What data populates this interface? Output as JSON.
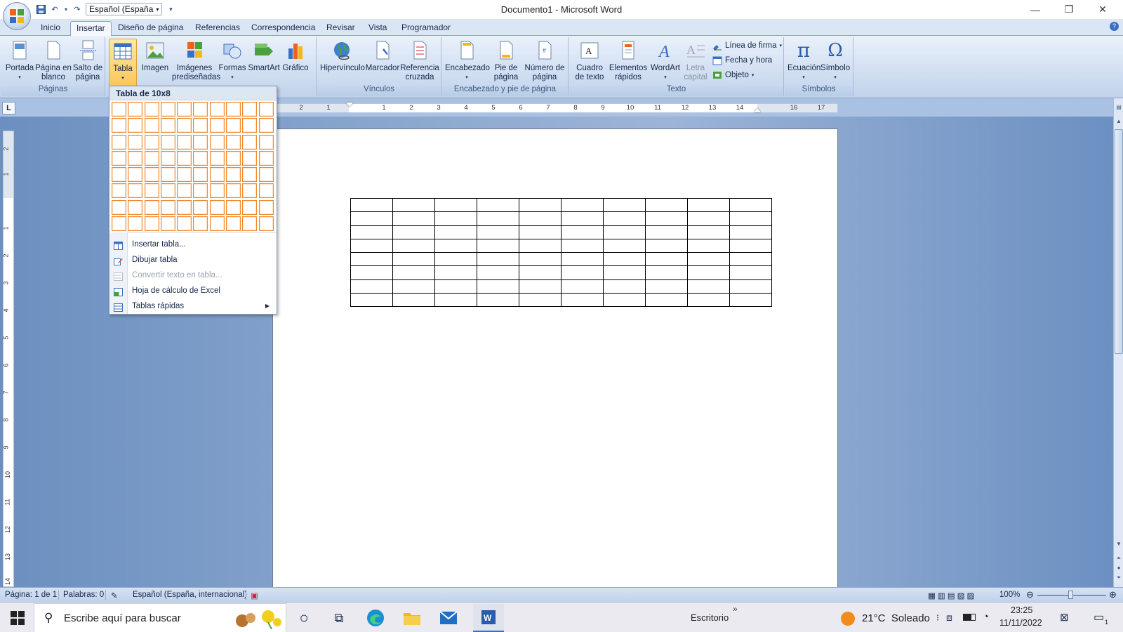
{
  "window": {
    "title": "Documento1 - Microsoft Word",
    "language_box": "Español (España",
    "minimize": "—",
    "restore": "❐",
    "close": "✕"
  },
  "tabs": [
    "Inicio",
    "Insertar",
    "Diseño de página",
    "Referencias",
    "Correspondencia",
    "Revisar",
    "Vista",
    "Programador"
  ],
  "ribbon": {
    "groups": {
      "paginas": "Páginas",
      "vinculos": "Vínculos",
      "encabezado": "Encabezado y pie de página",
      "texto": "Texto",
      "simbolos": "Símbolos"
    },
    "buttons": {
      "portada": "Portada",
      "pagina_en_blanco_1": "Página en",
      "pagina_en_blanco_2": "blanco",
      "salto_1": "Salto de",
      "salto_2": "página",
      "tabla": "Tabla",
      "imagen": "Imagen",
      "imagenes_1": "Imágenes",
      "imagenes_2": "prediseñadas",
      "formas": "Formas",
      "smartart": "SmartArt",
      "grafico": "Gráfico",
      "hipervinculo": "Hipervínculo",
      "marcador": "Marcador",
      "referencia_1": "Referencia",
      "referencia_2": "cruzada",
      "encabezado": "Encabezado",
      "pie_1": "Pie de",
      "pie_2": "página",
      "numero_1": "Número de",
      "numero_2": "página",
      "cuadro_1": "Cuadro",
      "cuadro_2": "de texto",
      "elementos_1": "Elementos",
      "elementos_2": "rápidos",
      "wordart": "WordArt",
      "letra_1": "Letra",
      "letra_2": "capital",
      "linea_firma": "Línea de firma",
      "fecha_hora": "Fecha y hora",
      "objeto": "Objeto",
      "ecuacion": "Ecuación",
      "simbolo": "Símbolo"
    }
  },
  "table_menu": {
    "title": "Tabla de 10x8",
    "grid_cols": 10,
    "grid_rows": 8,
    "items": [
      {
        "label": "Insertar tabla...",
        "enabled": true
      },
      {
        "label": "Dibujar tabla",
        "enabled": true
      },
      {
        "label": "Convertir texto en tabla...",
        "enabled": false
      },
      {
        "label": "Hoja de cálculo de Excel",
        "enabled": true
      },
      {
        "label": "Tablas rápidas",
        "enabled": true
      }
    ]
  },
  "ruler": {
    "h_numbers": [
      "2",
      "1",
      "1",
      "2",
      "3",
      "4",
      "5",
      "6",
      "7",
      "8",
      "9",
      "10",
      "11",
      "12",
      "13",
      "14",
      "16",
      "17"
    ],
    "v_numbers": [
      "2",
      "1",
      "1",
      "2",
      "3",
      "4",
      "5",
      "6",
      "7",
      "8",
      "9",
      "10",
      "11",
      "12",
      "13",
      "14"
    ]
  },
  "document": {
    "table_cols": 10,
    "table_rows": 8
  },
  "statusbar": {
    "page": "Página: 1 de 1",
    "words": "Palabras: 0",
    "language": "Español (España, internacional)",
    "zoom": "100%"
  },
  "taskbar": {
    "search_placeholder": "Escribe aquí para buscar",
    "desktop": "Escritorio",
    "weather": "21°C  Soleado",
    "time": "23:25",
    "date": "11/11/2022",
    "notification_count": "1"
  },
  "colors": {
    "ribbon_accent": "#fbc75b",
    "grid_border": "#f08a32",
    "tab_bar": "#dbe6f4"
  }
}
